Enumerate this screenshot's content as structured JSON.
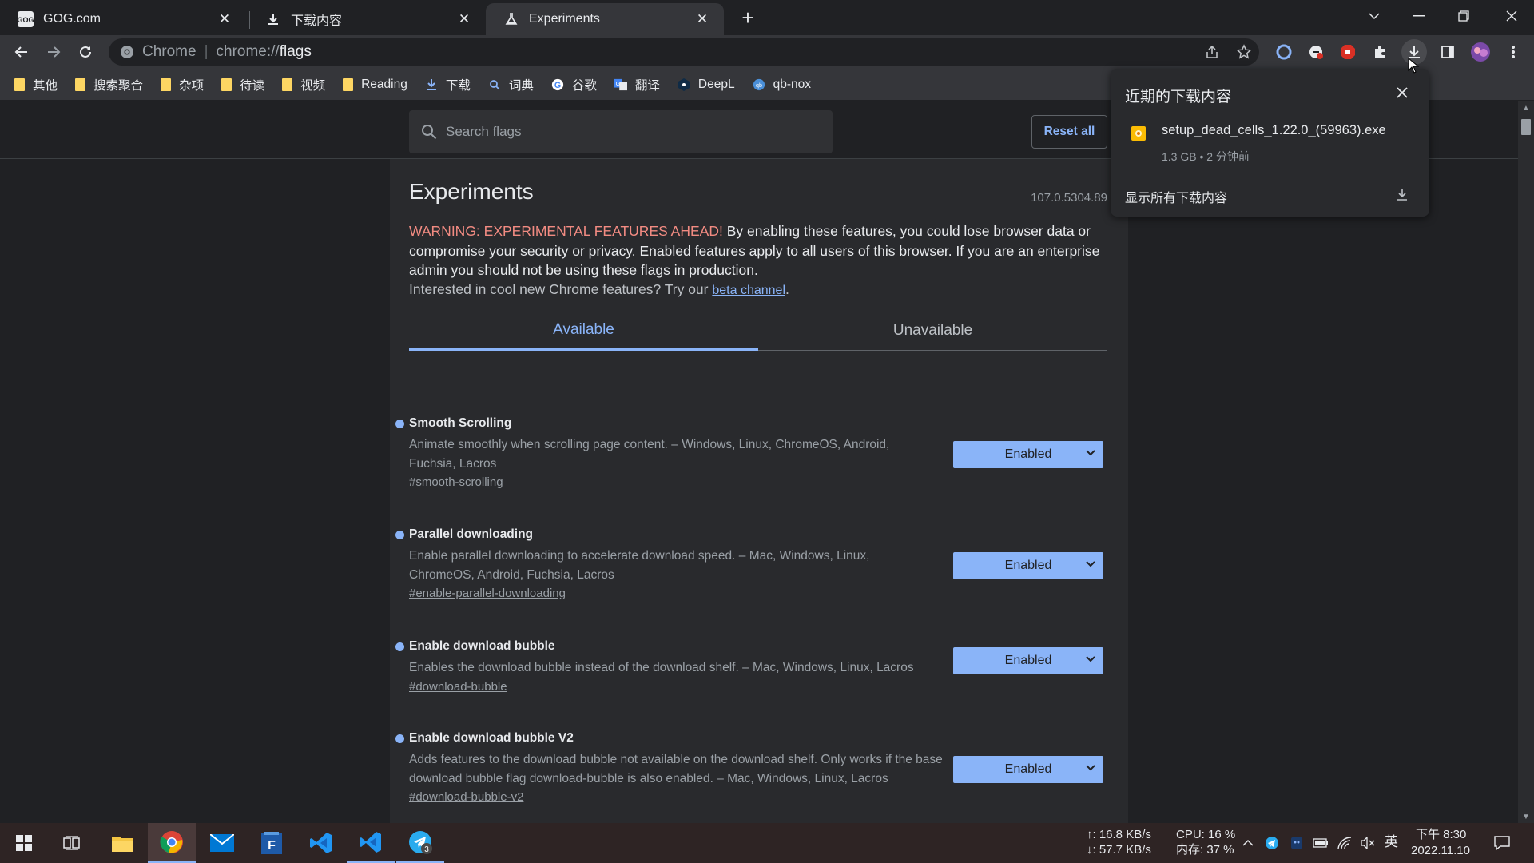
{
  "tabs": [
    {
      "title": "GOG.com",
      "icon": "gog-icon",
      "active": false
    },
    {
      "title": "下载内容",
      "icon": "download-icon",
      "active": false
    },
    {
      "title": "Experiments",
      "icon": "flask-icon",
      "active": true
    }
  ],
  "omnibox": {
    "site": "Chrome",
    "url_scheme": "chrome://",
    "url_host": "flags"
  },
  "bookmarks": [
    {
      "label": "其他",
      "icon": "folder-icon"
    },
    {
      "label": "搜索聚合",
      "icon": "folder-icon"
    },
    {
      "label": "杂项",
      "icon": "folder-icon"
    },
    {
      "label": "待读",
      "icon": "folder-icon"
    },
    {
      "label": "视频",
      "icon": "folder-icon"
    },
    {
      "label": "Reading",
      "icon": "folder-icon"
    },
    {
      "label": "下载",
      "icon": "download-icon"
    },
    {
      "label": "词典",
      "icon": "search-icon"
    },
    {
      "label": "谷歌",
      "icon": "google-icon"
    },
    {
      "label": "翻译",
      "icon": "translate-icon"
    },
    {
      "label": "DeepL",
      "icon": "deepl-icon"
    },
    {
      "label": "qb-nox",
      "icon": "qbittorrent-icon"
    }
  ],
  "flags_page": {
    "search_placeholder": "Search flags",
    "reset_label": "Reset all",
    "title": "Experiments",
    "version": "107.0.5304.89",
    "warning_red": "WARNING: EXPERIMENTAL FEATURES AHEAD!",
    "warning_rest": " By enabling these features, you could lose browser data or compromise your security or privacy. Enabled features apply to all users of this browser. If you are an enterprise admin you should not be using these flags in production.",
    "interest_text": "Interested in cool new Chrome features? Try our ",
    "interest_link": "beta channel",
    "interest_end": ".",
    "tab_available": "Available",
    "tab_unavailable": "Unavailable",
    "flags": [
      {
        "name": "Smooth Scrolling",
        "desc": "Animate smoothly when scrolling page content. – Windows, Linux, ChromeOS, Android, Fuchsia, Lacros",
        "link": "#smooth-scrolling",
        "value": "Enabled"
      },
      {
        "name": "Parallel downloading",
        "desc": "Enable parallel downloading to accelerate download speed. – Mac, Windows, Linux, ChromeOS, Android, Fuchsia, Lacros",
        "link": "#enable-parallel-downloading",
        "value": "Enabled"
      },
      {
        "name": "Enable download bubble",
        "desc": "Enables the download bubble instead of the download shelf. – Mac, Windows, Linux, Lacros",
        "link": "#download-bubble",
        "value": "Enabled"
      },
      {
        "name": "Enable download bubble V2",
        "desc": "Adds features to the download bubble not available on the download shelf. Only works if the base download bubble flag download-bubble is also enabled. – Mac, Windows, Linux, Lacros",
        "link": "#download-bubble-v2",
        "value": "Enabled"
      }
    ]
  },
  "download_bubble": {
    "title": "近期的下载内容",
    "file_name": "setup_dead_cells_1.22.0_(59963).exe",
    "file_meta": "1.3 GB • 2 分钟前",
    "show_all": "显示所有下载内容"
  },
  "taskbar": {
    "net_up": "↑: 16.8 KB/s",
    "net_down": "↓: 57.7 KB/s",
    "cpu": "CPU: 16 %",
    "mem": "内存: 37 %",
    "ime": "英",
    "time": "下午 8:30",
    "date": "2022.11.10",
    "telegram_badge": "3"
  },
  "colors": {
    "accent": "#8ab4f8",
    "warning": "#f28b82",
    "page_bg": "#202124",
    "panel_bg": "#292a2d"
  }
}
